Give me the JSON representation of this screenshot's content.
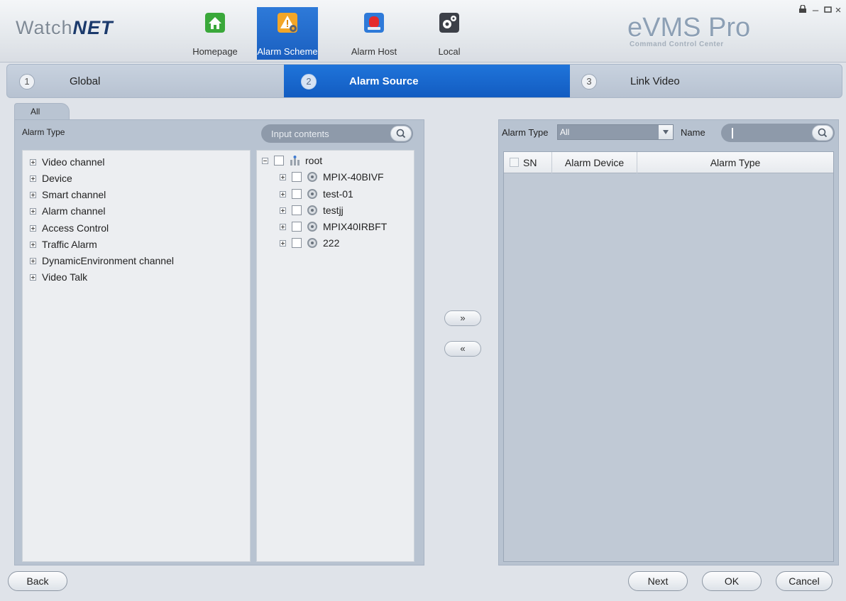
{
  "header": {
    "logo_a": "Watch",
    "logo_b": "NET",
    "brand": "eVMS Pro",
    "brand_sub": "Command Control Center",
    "nav": [
      {
        "label": "Homepage",
        "icon": "home-icon",
        "color": "#3aa83a"
      },
      {
        "label": "Alarm Scheme",
        "icon": "alarm-scheme-icon",
        "color": "#f0a020",
        "active": true
      },
      {
        "label": "Alarm Host",
        "icon": "alarm-host-icon",
        "color": "#e03030"
      },
      {
        "label": "Local",
        "icon": "gear-icon",
        "color": "#3c4048"
      }
    ],
    "window_controls": [
      "lock-icon",
      "minimize-icon",
      "maximize-icon",
      "close-icon"
    ]
  },
  "steps": [
    {
      "num": "1",
      "label": "Global"
    },
    {
      "num": "2",
      "label": "Alarm Source",
      "active": true
    },
    {
      "num": "3",
      "label": "Link Video"
    }
  ],
  "tab": {
    "label": "All"
  },
  "left": {
    "alarm_type_label": "Alarm Type",
    "search_placeholder": "Input contents",
    "alarm_types": [
      "Video channel",
      "Device",
      "Smart channel",
      "Alarm channel",
      "Access Control",
      "Traffic Alarm",
      "DynamicEnvironment channel",
      "Video Talk"
    ],
    "tree": {
      "root": "root",
      "devices": [
        "MPIX-40BIVF",
        "test-01",
        "testjj",
        "MPIX40IRBFT",
        "222"
      ]
    }
  },
  "transfer": {
    "add": "»",
    "remove": "«"
  },
  "right": {
    "alarm_type_label": "Alarm Type",
    "alarm_type_value": "All",
    "name_label": "Name",
    "name_value": "",
    "columns": [
      "SN",
      "Alarm Device",
      "Alarm Type"
    ]
  },
  "footer": {
    "back": "Back",
    "next": "Next",
    "ok": "OK",
    "cancel": "Cancel"
  },
  "colors": {
    "accent": "#1a64c8",
    "panel": "#b8c3d1",
    "list_bg": "#eceef1"
  }
}
